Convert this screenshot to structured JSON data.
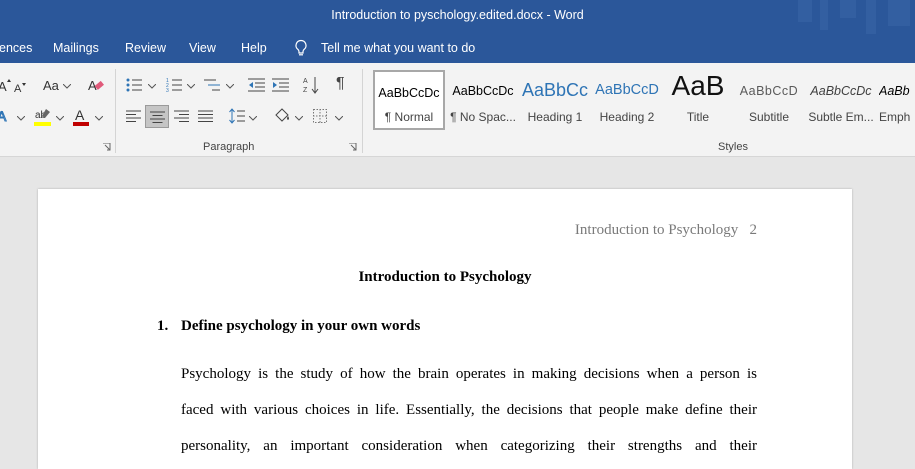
{
  "window": {
    "title": "Introduction to pyschology.edited.docx  -  Word"
  },
  "tabs": [
    "ences",
    "Mailings",
    "Review",
    "View",
    "Help"
  ],
  "tell_me": {
    "label": "Tell me what you want to do",
    "icon": "lightbulb-icon"
  },
  "ribbon": {
    "paragraph_label": "Paragraph",
    "styles_label": "Styles",
    "styles": [
      {
        "sample": "AaBbCcDc",
        "name": "¶ Normal"
      },
      {
        "sample": "AaBbCcDc",
        "name": "¶ No Spac..."
      },
      {
        "sample": "AaBbCc",
        "name": "Heading 1"
      },
      {
        "sample": "AaBbCcD",
        "name": "Heading 2"
      },
      {
        "sample": "AaB",
        "name": "Title"
      },
      {
        "sample": "AaBbCcD",
        "name": "Subtitle"
      },
      {
        "sample": "AaBbCcDc",
        "name": "Subtle Em..."
      },
      {
        "sample": "AaBb",
        "name": "Emph"
      }
    ],
    "font_size_label": "Aa"
  },
  "colors": {
    "title_bar": "#2b579a",
    "heading_blue": "#2e74b5",
    "highlight_yellow": "#ffff00",
    "font_red": "#c00000"
  },
  "document": {
    "header_text": "Introduction to Psychology",
    "page_number": "2",
    "title": "Introduction to Psychology",
    "item_number": "1.",
    "item_heading": "Define psychology in your own words",
    "paragraph_lines": [
      "Psychology is the study of how the brain operates in making decisions when a person is",
      "faced with various choices in life. Essentially, the decisions that people make define their",
      "personality, an important consideration when categorizing their strengths and their"
    ]
  }
}
